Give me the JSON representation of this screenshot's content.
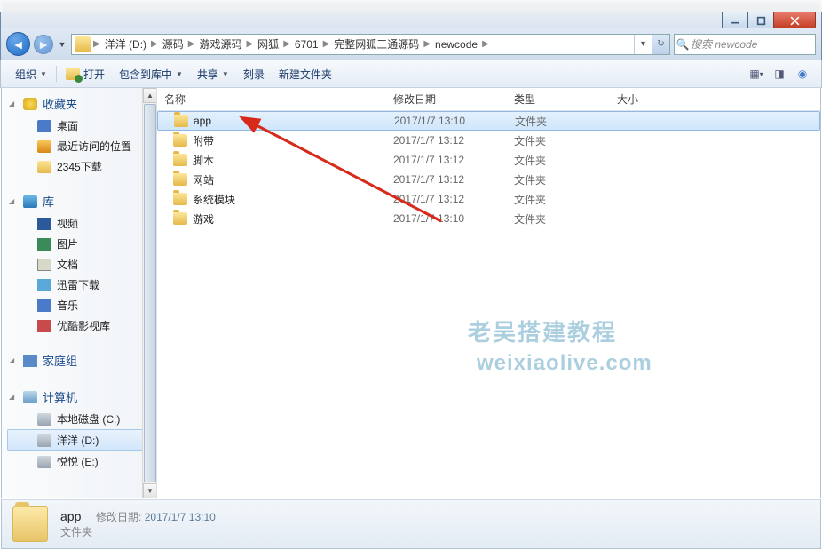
{
  "breadcrumb": {
    "items": [
      "洋洋 (D:)",
      "源码",
      "游戏源码",
      "网狐",
      "6701",
      "完整网狐三通源码",
      "newcode"
    ]
  },
  "search": {
    "placeholder": "搜索 newcode"
  },
  "toolbar": {
    "organize": "组织",
    "open": "打开",
    "include": "包含到库中",
    "share": "共享",
    "burn": "刻录",
    "newfolder": "新建文件夹"
  },
  "columns": {
    "name": "名称",
    "date": "修改日期",
    "type": "类型",
    "size": "大小"
  },
  "files": [
    {
      "name": "app",
      "date": "2017/1/7 13:10",
      "type": "文件夹",
      "selected": true
    },
    {
      "name": "附带",
      "date": "2017/1/7 13:12",
      "type": "文件夹"
    },
    {
      "name": "脚本",
      "date": "2017/1/7 13:12",
      "type": "文件夹"
    },
    {
      "name": "网站",
      "date": "2017/1/7 13:12",
      "type": "文件夹"
    },
    {
      "name": "系统模块",
      "date": "2017/1/7 13:12",
      "type": "文件夹"
    },
    {
      "name": "游戏",
      "date": "2017/1/7 13:10",
      "type": "文件夹"
    }
  ],
  "sidebar": {
    "favorites": {
      "label": "收藏夹",
      "items": [
        "桌面",
        "最近访问的位置",
        "2345下载"
      ]
    },
    "libraries": {
      "label": "库",
      "items": [
        "视频",
        "图片",
        "文档",
        "迅雷下载",
        "音乐",
        "优酷影视库"
      ]
    },
    "homegroup": {
      "label": "家庭组"
    },
    "computer": {
      "label": "计算机",
      "items": [
        "本地磁盘 (C:)",
        "洋洋 (D:)",
        "悦悦 (E:)"
      ]
    }
  },
  "status": {
    "name": "app",
    "type": "文件夹",
    "date_label": "修改日期:",
    "date": "2017/1/7 13:10"
  },
  "watermark": {
    "line1": "老吴搭建教程",
    "line2": "weixiaolive.com"
  }
}
